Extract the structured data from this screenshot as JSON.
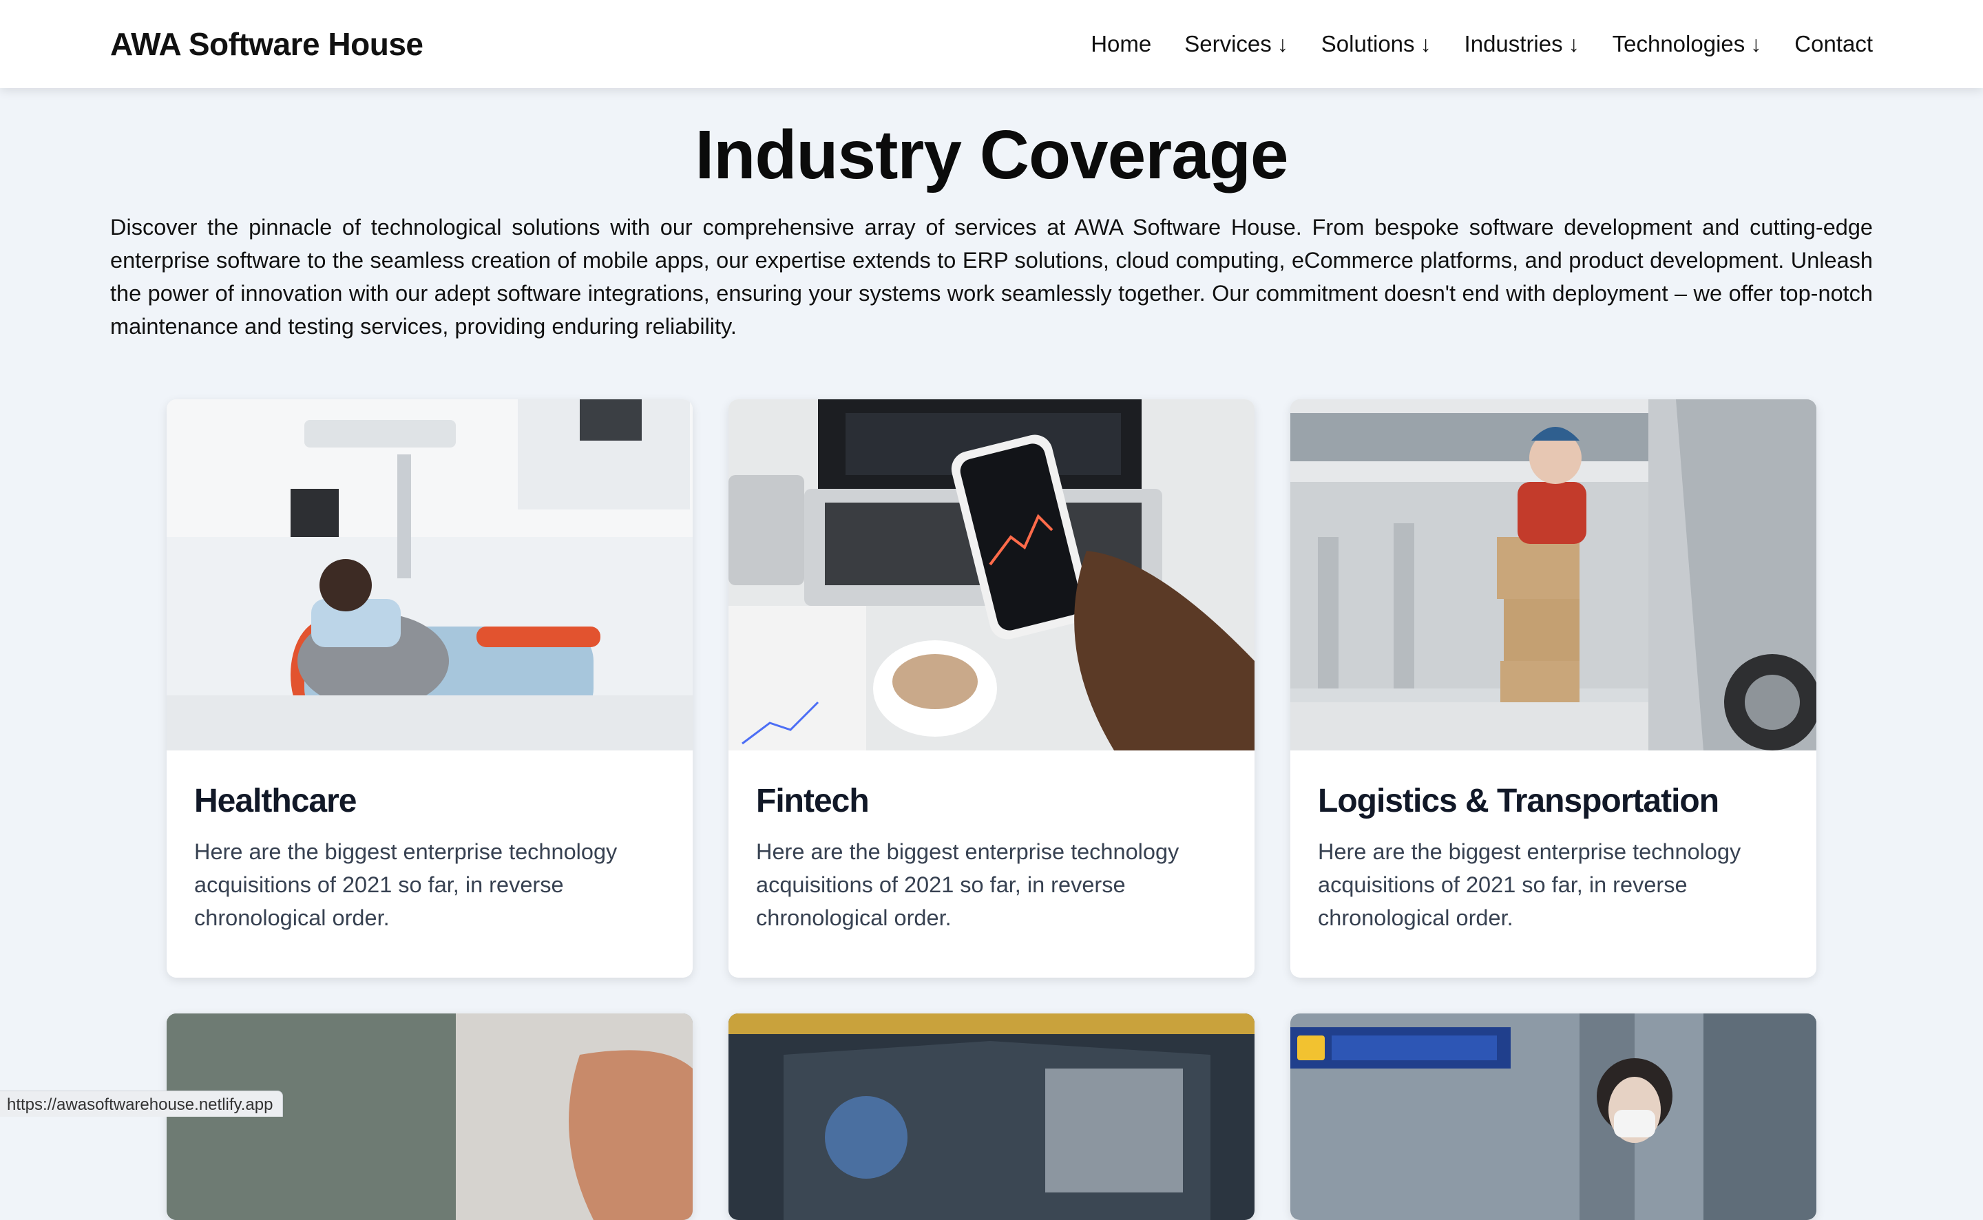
{
  "header": {
    "brand": "AWA Software House",
    "nav": [
      {
        "label": "Home",
        "arrow": ""
      },
      {
        "label": "Services",
        "arrow": "↓"
      },
      {
        "label": "Solutions",
        "arrow": "↓"
      },
      {
        "label": "Industries",
        "arrow": "↓"
      },
      {
        "label": "Technologies",
        "arrow": "↓"
      },
      {
        "label": "Contact",
        "arrow": ""
      }
    ]
  },
  "main": {
    "title": "Industry Coverage",
    "intro": "Discover the pinnacle of technological solutions with our comprehensive array of services at AWA Software House. From bespoke software development and cutting-edge enterprise software to the seamless creation of mobile apps, our expertise extends to ERP solutions, cloud computing, eCommerce platforms, and product development. Unleash the power of innovation with our adept software integrations, ensuring your systems work seamlessly together. Our commitment doesn't end with deployment – we offer top-notch maintenance and testing services, providing enduring reliability.",
    "cards": [
      {
        "title": "Healthcare",
        "text": "Here are the biggest enterprise technology acquisitions of 2021 so far, in reverse chronological order."
      },
      {
        "title": "Fintech",
        "text": "Here are the biggest enterprise technology acquisitions of 2021 so far, in reverse chronological order."
      },
      {
        "title": "Logistics & Transportation",
        "text": "Here are the biggest enterprise technology acquisitions of 2021 so far, in reverse chronological order."
      }
    ]
  },
  "status_bar": {
    "url": "https://awasoftwarehouse.netlify.app"
  }
}
